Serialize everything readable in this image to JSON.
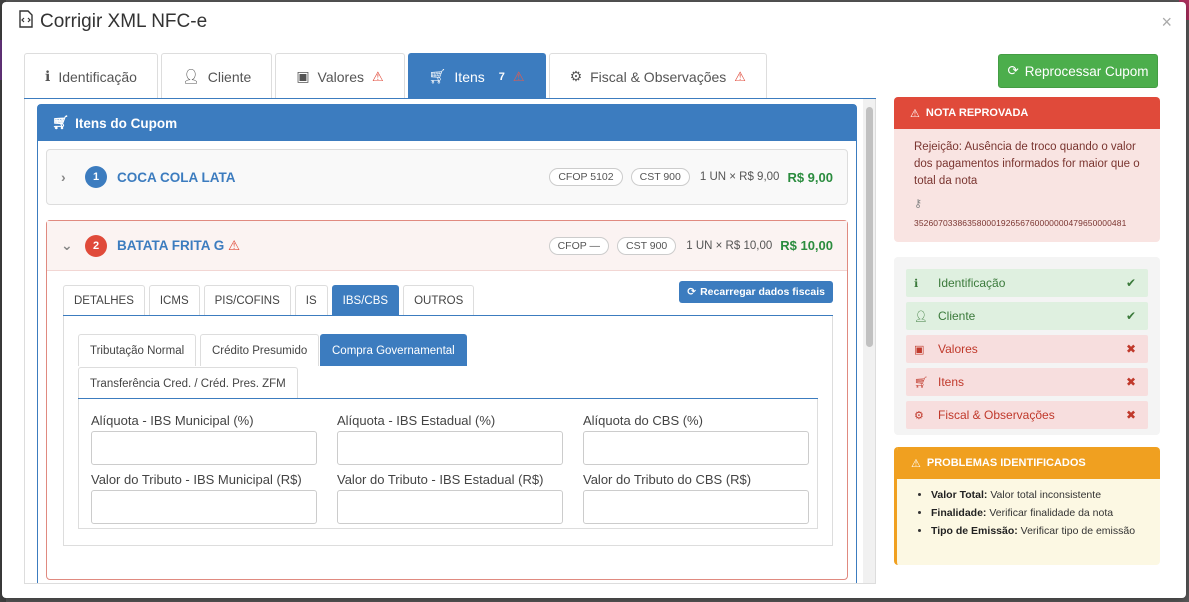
{
  "modal": {
    "title": "Corrigir XML NFC-e",
    "close": "×"
  },
  "tabs": [
    {
      "label": "Identificação",
      "icon": "info-icon",
      "warn": "",
      "count": ""
    },
    {
      "label": "Cliente",
      "icon": "user-icon",
      "warn": "",
      "count": ""
    },
    {
      "label": "Valores",
      "icon": "money-icon",
      "warn": "⚠",
      "count": ""
    },
    {
      "label": "Itens",
      "icon": "cart-icon",
      "warn": "⚠",
      "count": "7"
    },
    {
      "label": "Fiscal & Observações",
      "icon": "gears-icon",
      "warn": "⚠",
      "count": ""
    }
  ],
  "box": {
    "title": "Itens do Cupom"
  },
  "items": [
    {
      "num": "1",
      "name": "COCA COLA LATA",
      "cfop": "CFOP 5102",
      "cst": "CST 900",
      "qty": "1 UN × R$ 9,00",
      "price": "R$ 9,00"
    },
    {
      "num": "2",
      "name": "BATATA FRITA G",
      "cfop": "CFOP —",
      "cst": "CST 900",
      "qty": "1 UN × R$ 10,00",
      "price": "R$ 10,00"
    }
  ],
  "subtabs": [
    "DETALHES",
    "ICMS",
    "PIS/COFINS",
    "IS",
    "IBS/CBS",
    "OUTROS"
  ],
  "reload_label": "Recarregar dados fiscais",
  "tributacao_tabs": [
    "Tributação Normal",
    "Crédito Presumido",
    "Compra Governamental",
    "Transferência Cred. / Créd. Pres. ZFM"
  ],
  "fields": [
    {
      "label": "Alíquota - IBS Municipal (%)",
      "value": ""
    },
    {
      "label": "Alíquota - IBS Estadual (%)",
      "value": ""
    },
    {
      "label": "Alíquota do CBS (%)",
      "value": ""
    },
    {
      "label": "Valor do Tributo - IBS Municipal (R$)",
      "value": ""
    },
    {
      "label": "Valor do Tributo - IBS Estadual (R$)",
      "value": ""
    },
    {
      "label": "Valor do Tributo do CBS (R$)",
      "value": ""
    }
  ],
  "reprocess_label": "Reprocessar Cupom",
  "rejection": {
    "title": "NOTA REPROVADA",
    "message": "Rejeição: Ausência de troco quando o valor dos pagamentos informados for maior que o total da nota",
    "key": "35260703386358000192656760000000479650000481"
  },
  "steps": [
    {
      "label": "Identificação",
      "status": "ok",
      "mark": "✔"
    },
    {
      "label": "Cliente",
      "status": "ok",
      "mark": "✔"
    },
    {
      "label": "Valores",
      "status": "bad",
      "mark": "✖"
    },
    {
      "label": "Itens",
      "status": "bad",
      "mark": "✖"
    },
    {
      "label": "Fiscal & Observações",
      "status": "bad",
      "mark": "✖"
    }
  ],
  "problems": {
    "title": "PROBLEMAS IDENTIFICADOS",
    "list": [
      {
        "key": "Valor Total:",
        "text": "Valor total inconsistente"
      },
      {
        "key": "Finalidade:",
        "text": "Verificar finalidade da nota"
      },
      {
        "key": "Tipo de Emissão:",
        "text": "Verificar tipo de emissão"
      }
    ]
  },
  "colors": {
    "primary": "#3c7cbf",
    "success": "#4cae4c",
    "danger": "#e04a3a",
    "warning": "#f0a020"
  }
}
